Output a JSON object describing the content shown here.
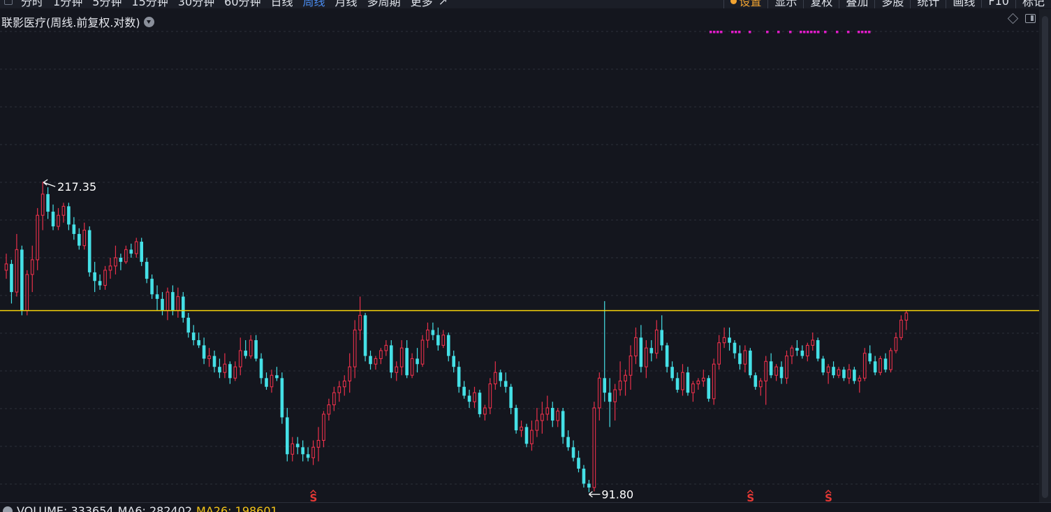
{
  "toolbar": {
    "periods": [
      "分时",
      "1分钟",
      "5分钟",
      "15分钟",
      "30分钟",
      "60分钟",
      "日线",
      "周线",
      "月线",
      "多周期",
      "更多"
    ],
    "active_period": "周线",
    "more_arrow": "↗",
    "tools": [
      "设置",
      "显示",
      "复权",
      "叠加",
      "多股",
      "统计",
      "画线",
      "F10",
      "标记"
    ]
  },
  "chart": {
    "title": "联影医疗(周线.前复权.对数)",
    "high_label": "217.35",
    "low_label": "91.80",
    "signal_mark": "S",
    "signal_positions": [
      59,
      143,
      158,
      230
    ],
    "up_color": "#e8304a",
    "down_color": "#45e0e6",
    "hline_color": "#f5d20b",
    "hline_price": 152.0,
    "log_scale": true,
    "price_range": [
      90.5,
      226.0
    ]
  },
  "volume_bar": {
    "label_volume": "VOLUME: 333654",
    "label_ma6": "MA6: 282402",
    "label_ma26": "MA26: 198601"
  },
  "chart_data": {
    "type": "candlestick",
    "title": "联影医疗(周线.前复权.对数)",
    "hline": 152.0,
    "candles": [
      [
        170.0,
        178.0,
        166.0,
        173.0
      ],
      [
        173.0,
        175.0,
        155.0,
        160.0
      ],
      [
        160.0,
        188.0,
        158.0,
        180.0
      ],
      [
        180.0,
        182.0,
        150.0,
        152.0
      ],
      [
        152.0,
        170.0,
        150.0,
        168.0
      ],
      [
        168.0,
        182.0,
        160.0,
        175.0
      ],
      [
        175.0,
        202.0,
        170.0,
        198.0
      ],
      [
        198.0,
        217.35,
        190.0,
        210.0
      ],
      [
        210.0,
        214.0,
        196.0,
        200.0
      ],
      [
        200.0,
        204.0,
        190.0,
        192.0
      ],
      [
        192.0,
        202.0,
        190.0,
        198.0
      ],
      [
        198.0,
        205.0,
        194.0,
        203.0
      ],
      [
        203.0,
        205.0,
        190.0,
        193.0
      ],
      [
        193.0,
        197.0,
        185.0,
        188.0
      ],
      [
        188.0,
        191.0,
        180.0,
        182.0
      ],
      [
        182.0,
        194.0,
        180.0,
        190.0
      ],
      [
        190.0,
        192.0,
        167.0,
        169.0
      ],
      [
        169.0,
        174.0,
        160.0,
        165.0
      ],
      [
        165.0,
        168.0,
        161.0,
        163.0
      ],
      [
        163.0,
        172.0,
        161.0,
        170.0
      ],
      [
        170.0,
        176.0,
        166.0,
        172.0
      ],
      [
        172.0,
        182.0,
        168.0,
        176.0
      ],
      [
        176.0,
        178.0,
        170.0,
        174.0
      ],
      [
        174.0,
        182.0,
        173.0,
        180.0
      ],
      [
        180.0,
        183.0,
        176.0,
        178.0
      ],
      [
        178.0,
        186.0,
        176.0,
        184.0
      ],
      [
        184.0,
        186.0,
        172.0,
        174.0
      ],
      [
        174.0,
        176.0,
        164.0,
        166.0
      ],
      [
        166.0,
        168.0,
        157.0,
        159.0
      ],
      [
        159.0,
        163.0,
        152.0,
        157.0
      ],
      [
        157.0,
        160.0,
        150.0,
        152.0
      ],
      [
        152.0,
        162.0,
        148.0,
        160.0
      ],
      [
        160.0,
        163.0,
        150.0,
        152.0
      ],
      [
        152.0,
        162.0,
        149.0,
        158.0
      ],
      [
        158.0,
        160.0,
        147.0,
        149.0
      ],
      [
        149.0,
        151.0,
        141.0,
        143.0
      ],
      [
        143.0,
        146.0,
        138.0,
        140.0
      ],
      [
        140.0,
        143.0,
        137.0,
        138.0
      ],
      [
        138.0,
        141.0,
        131.0,
        133.0
      ],
      [
        133.0,
        137.0,
        130.0,
        134.0
      ],
      [
        134.0,
        136.0,
        128.0,
        130.0
      ],
      [
        130.0,
        133.0,
        126.0,
        128.0
      ],
      [
        128.0,
        135.0,
        126.0,
        131.0
      ],
      [
        131.0,
        132.0,
        124.0,
        126.0
      ],
      [
        126.0,
        132.0,
        125.0,
        130.0
      ],
      [
        130.0,
        141.0,
        127.0,
        136.0
      ],
      [
        136.0,
        140.0,
        133.0,
        134.0
      ],
      [
        134.0,
        142.0,
        133.0,
        140.0
      ],
      [
        140.0,
        142.0,
        132.0,
        133.0
      ],
      [
        133.0,
        135.0,
        124.0,
        126.0
      ],
      [
        126.0,
        128.0,
        122.0,
        123.0
      ],
      [
        123.0,
        129.0,
        121.0,
        127.0
      ],
      [
        127.0,
        130.0,
        125.0,
        126.0
      ],
      [
        126.0,
        128.0,
        111.0,
        113.0
      ],
      [
        113.0,
        116.0,
        100.0,
        102.0
      ],
      [
        102.0,
        107.0,
        100.0,
        105.0
      ],
      [
        105.0,
        107.0,
        102.0,
        104.0
      ],
      [
        104.0,
        106.0,
        100.0,
        102.0
      ],
      [
        102.0,
        104.0,
        100.0,
        101.0
      ],
      [
        101.0,
        106.0,
        99.0,
        104.0
      ],
      [
        104.0,
        110.0,
        100.0,
        106.0
      ],
      [
        106.0,
        115.0,
        104.0,
        114.0
      ],
      [
        114.0,
        119.0,
        112.0,
        117.0
      ],
      [
        117.0,
        123.0,
        115.0,
        121.0
      ],
      [
        121.0,
        125.0,
        118.0,
        123.0
      ],
      [
        123.0,
        127.0,
        120.0,
        125.0
      ],
      [
        125.0,
        135.0,
        121.0,
        130.0
      ],
      [
        130.0,
        148.0,
        126.0,
        144.0
      ],
      [
        144.0,
        158.0,
        140.0,
        150.0
      ],
      [
        150.0,
        151.0,
        132.0,
        134.0
      ],
      [
        134.0,
        136.0,
        129.0,
        131.0
      ],
      [
        131.0,
        134.0,
        129.0,
        133.0
      ],
      [
        133.0,
        137.0,
        131.0,
        136.0
      ],
      [
        136.0,
        140.0,
        134.0,
        138.0
      ],
      [
        138.0,
        140.0,
        126.0,
        128.0
      ],
      [
        128.0,
        132.0,
        125.0,
        130.0
      ],
      [
        130.0,
        140.0,
        127.0,
        137.0
      ],
      [
        137.0,
        140.0,
        126.0,
        127.0
      ],
      [
        127.0,
        135.0,
        126.0,
        133.0
      ],
      [
        133.0,
        137.0,
        128.0,
        131.0
      ],
      [
        131.0,
        142.0,
        130.0,
        140.0
      ],
      [
        140.0,
        147.0,
        137.0,
        144.0
      ],
      [
        144.0,
        147.0,
        140.0,
        142.0
      ],
      [
        142.0,
        145.0,
        136.0,
        138.0
      ],
      [
        138.0,
        144.0,
        137.0,
        142.0
      ],
      [
        142.0,
        143.0,
        132.0,
        134.0
      ],
      [
        134.0,
        136.0,
        128.0,
        130.0
      ],
      [
        130.0,
        132.0,
        121.0,
        123.0
      ],
      [
        123.0,
        125.0,
        119.0,
        120.0
      ],
      [
        120.0,
        122.0,
        116.0,
        118.0
      ],
      [
        118.0,
        123.0,
        116.0,
        121.0
      ],
      [
        121.0,
        122.0,
        113.0,
        114.0
      ],
      [
        114.0,
        117.0,
        112.0,
        116.0
      ],
      [
        116.0,
        126.0,
        114.0,
        124.0
      ],
      [
        124.0,
        132.0,
        122.0,
        128.0
      ],
      [
        128.0,
        129.0,
        123.0,
        125.0
      ],
      [
        125.0,
        128.0,
        121.0,
        123.0
      ],
      [
        123.0,
        124.0,
        114.0,
        116.0
      ],
      [
        116.0,
        117.0,
        108.0,
        109.0
      ],
      [
        109.0,
        112.0,
        107.0,
        110.0
      ],
      [
        110.0,
        111.0,
        104.0,
        105.0
      ],
      [
        105.0,
        112.0,
        103.0,
        109.0
      ],
      [
        109.0,
        116.0,
        107.0,
        112.0
      ],
      [
        112.0,
        118.0,
        108.0,
        114.0
      ],
      [
        114.0,
        120.0,
        112.0,
        116.0
      ],
      [
        116.0,
        118.0,
        110.0,
        112.0
      ],
      [
        112.0,
        116.0,
        110.0,
        115.0
      ],
      [
        115.0,
        116.0,
        105.0,
        107.0
      ],
      [
        107.0,
        109.0,
        103.0,
        104.0
      ],
      [
        104.0,
        106.0,
        100.0,
        101.0
      ],
      [
        101.0,
        103.0,
        97.0,
        98.0
      ],
      [
        98.0,
        99.0,
        93.0,
        94.0
      ],
      [
        94.0,
        95.0,
        91.8,
        93.0
      ],
      [
        93.0,
        118.0,
        92.0,
        116.0
      ],
      [
        116.0,
        128.0,
        112.0,
        126.0
      ],
      [
        126.0,
        156.0,
        118.0,
        121.0
      ],
      [
        121.0,
        126.0,
        110.0,
        118.0
      ],
      [
        118.0,
        124.0,
        112.0,
        122.0
      ],
      [
        122.0,
        132.0,
        120.0,
        125.0
      ],
      [
        125.0,
        129.0,
        120.0,
        127.0
      ],
      [
        127.0,
        138.0,
        122.0,
        134.0
      ],
      [
        134.0,
        145.0,
        131.0,
        141.0
      ],
      [
        141.0,
        146.0,
        128.0,
        130.0
      ],
      [
        130.0,
        140.0,
        126.0,
        137.0
      ],
      [
        137.0,
        140.0,
        132.0,
        135.0
      ],
      [
        135.0,
        148.0,
        133.0,
        144.0
      ],
      [
        144.0,
        150.0,
        136.0,
        138.0
      ],
      [
        138.0,
        139.0,
        128.0,
        130.0
      ],
      [
        130.0,
        132.0,
        125.0,
        126.0
      ],
      [
        126.0,
        128.0,
        121.0,
        122.0
      ],
      [
        122.0,
        131.0,
        120.0,
        128.0
      ],
      [
        128.0,
        130.0,
        120.0,
        121.0
      ],
      [
        121.0,
        125.0,
        118.0,
        124.0
      ],
      [
        124.0,
        126.0,
        122.0,
        125.0
      ],
      [
        125.0,
        129.0,
        123.0,
        126.0
      ],
      [
        126.0,
        127.0,
        118.0,
        119.0
      ],
      [
        119.0,
        133.0,
        117.0,
        131.0
      ],
      [
        131.0,
        142.0,
        129.0,
        139.0
      ],
      [
        139.0,
        145.0,
        137.0,
        141.0
      ],
      [
        141.0,
        145.0,
        136.0,
        139.0
      ],
      [
        139.0,
        140.0,
        133.0,
        135.0
      ],
      [
        135.0,
        138.0,
        129.0,
        131.0
      ],
      [
        131.0,
        138.0,
        128.0,
        136.0
      ],
      [
        136.0,
        137.0,
        126.0,
        127.0
      ],
      [
        127.0,
        128.0,
        122.0,
        123.0
      ],
      [
        123.0,
        126.0,
        120.0,
        125.0
      ],
      [
        125.0,
        134.0,
        117.0,
        132.0
      ],
      [
        132.0,
        135.0,
        126.0,
        127.0
      ],
      [
        127.0,
        131.0,
        125.0,
        130.0
      ],
      [
        130.0,
        132.0,
        124.0,
        126.0
      ],
      [
        126.0,
        136.0,
        124.0,
        134.0
      ],
      [
        134.0,
        138.0,
        131.0,
        137.0
      ],
      [
        137.0,
        140.0,
        134.0,
        136.0
      ],
      [
        136.0,
        138.0,
        133.0,
        134.0
      ],
      [
        134.0,
        139.0,
        132.0,
        138.0
      ],
      [
        138.0,
        143.0,
        136.0,
        140.0
      ],
      [
        140.0,
        141.0,
        132.0,
        133.0
      ],
      [
        133.0,
        134.0,
        127.0,
        128.0
      ],
      [
        128.0,
        131.0,
        124.0,
        130.0
      ],
      [
        130.0,
        132.0,
        126.0,
        127.0
      ],
      [
        127.0,
        130.0,
        126.0,
        129.0
      ],
      [
        129.0,
        130.0,
        125.0,
        126.0
      ],
      [
        126.0,
        131.0,
        124.0,
        129.0
      ],
      [
        129.0,
        130.0,
        124.0,
        125.0
      ],
      [
        125.0,
        127.0,
        121.0,
        126.0
      ],
      [
        126.0,
        137.0,
        125.0,
        135.0
      ],
      [
        135.0,
        138.0,
        131.0,
        132.0
      ],
      [
        132.0,
        134.0,
        127.0,
        128.0
      ],
      [
        128.0,
        134.0,
        127.0,
        133.0
      ],
      [
        133.0,
        135.0,
        128.0,
        129.0
      ],
      [
        129.0,
        137.0,
        128.0,
        136.0
      ],
      [
        136.0,
        143.0,
        135.0,
        141.0
      ],
      [
        141.0,
        150.0,
        140.0,
        148.0
      ],
      [
        148.0,
        152.0,
        144.0,
        151.0
      ]
    ]
  }
}
